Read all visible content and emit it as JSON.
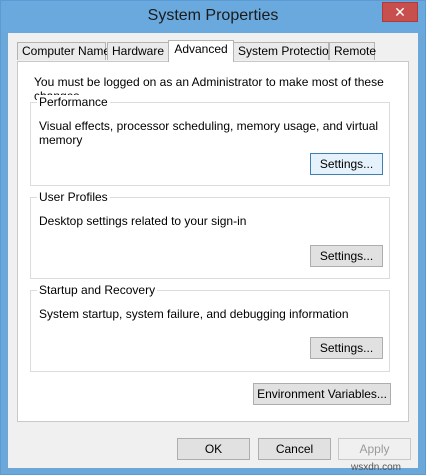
{
  "window": {
    "title": "System Properties",
    "close_glyph": "✕"
  },
  "tabs": [
    {
      "label": "Computer Name",
      "active": false
    },
    {
      "label": "Hardware",
      "active": false
    },
    {
      "label": "Advanced",
      "active": true
    },
    {
      "label": "System Protection",
      "active": false
    },
    {
      "label": "Remote",
      "active": false
    }
  ],
  "advanced": {
    "notice": "You must be logged on as an Administrator to make most of these changes.",
    "performance": {
      "label": "Performance",
      "description": "Visual effects, processor scheduling, memory usage, and virtual memory",
      "settings_button": "Settings..."
    },
    "user_profiles": {
      "label": "User Profiles",
      "description": "Desktop settings related to your sign-in",
      "settings_button": "Settings..."
    },
    "startup_recovery": {
      "label": "Startup and Recovery",
      "description": "System startup, system failure, and debugging information",
      "settings_button": "Settings..."
    },
    "environment_variables_button": "Environment Variables..."
  },
  "footer": {
    "ok": "OK",
    "cancel": "Cancel",
    "apply": "Apply"
  },
  "watermark": "wsxdn.com",
  "colors": {
    "titlebar": "#6aa9dd",
    "close_button": "#c7504e",
    "focus_border": "#3c7fb1"
  }
}
